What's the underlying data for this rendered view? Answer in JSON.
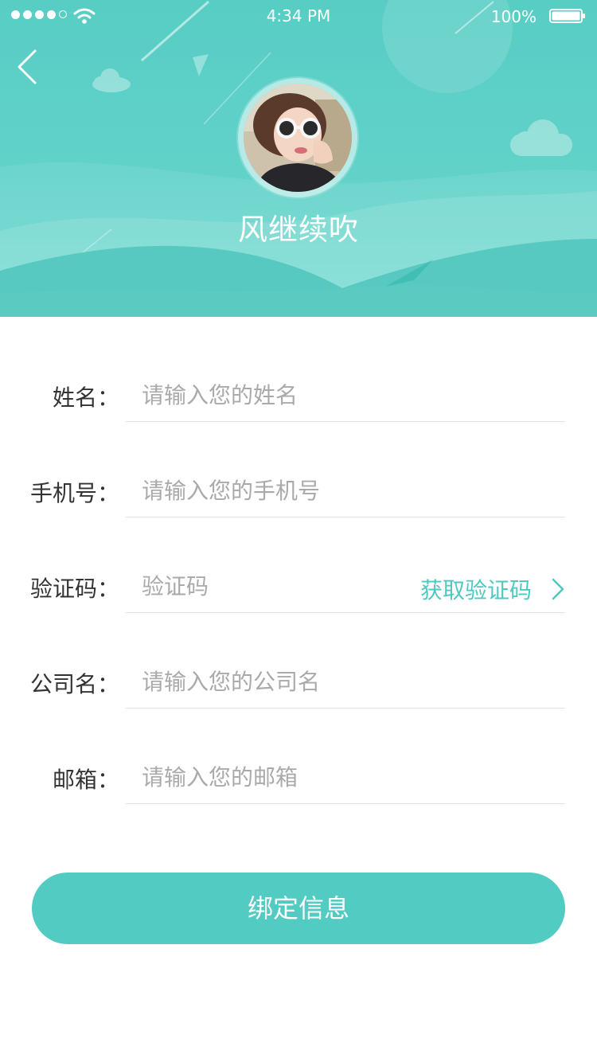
{
  "status_bar": {
    "time": "4:34 PM",
    "battery": "100%"
  },
  "header": {
    "username": "风继续吹",
    "back_icon": "chevron-left-icon"
  },
  "form": {
    "name": {
      "label": "姓名：",
      "placeholder": "请输入您的姓名"
    },
    "phone": {
      "label": "手机号：",
      "placeholder": "请输入您的手机号"
    },
    "code": {
      "label": "验证码：",
      "placeholder": "验证码",
      "action": "获取验证码",
      "action_icon": "chevron-right-icon"
    },
    "company": {
      "label": "公司名：",
      "placeholder": "请输入您的公司名"
    },
    "email": {
      "label": "邮箱：",
      "placeholder": "请输入您的邮箱"
    }
  },
  "submit_label": "绑定信息",
  "colors": {
    "accent": "#52cbc3",
    "header_bg": "#5fd0c7",
    "label": "#333333",
    "placeholder": "#aaaaaa"
  }
}
